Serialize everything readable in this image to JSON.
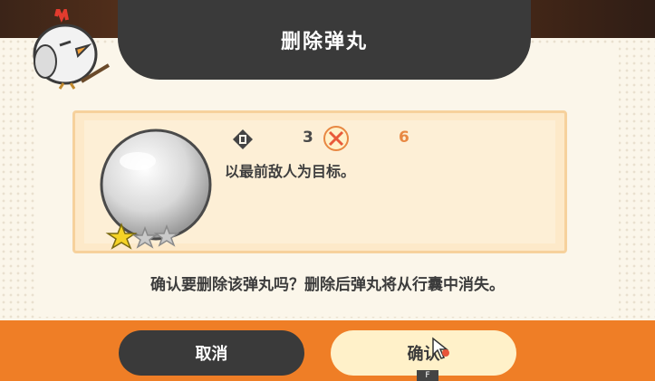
{
  "dialog": {
    "title": "删除弹丸",
    "stats": {
      "a_value": "3",
      "b_value": "6",
      "a_icon": "target-priority-icon",
      "b_icon": "crossed-swords-icon"
    },
    "item_description": "以最前敌人为目标。",
    "confirm_message": "确认要删除该弹丸吗？删除后弹丸将从行囊中消失。",
    "rarity_stars": 1,
    "rarity_max": 3
  },
  "buttons": {
    "cancel_label": "取消",
    "confirm_label": "确认",
    "confirm_key_hint": "F"
  },
  "colors": {
    "banner": "#3a3a3a",
    "footer": "#ef7e26",
    "cancel_button": "#3a3a3a",
    "confirm_button": "#fff1c9",
    "accent_value": "#e88843"
  }
}
